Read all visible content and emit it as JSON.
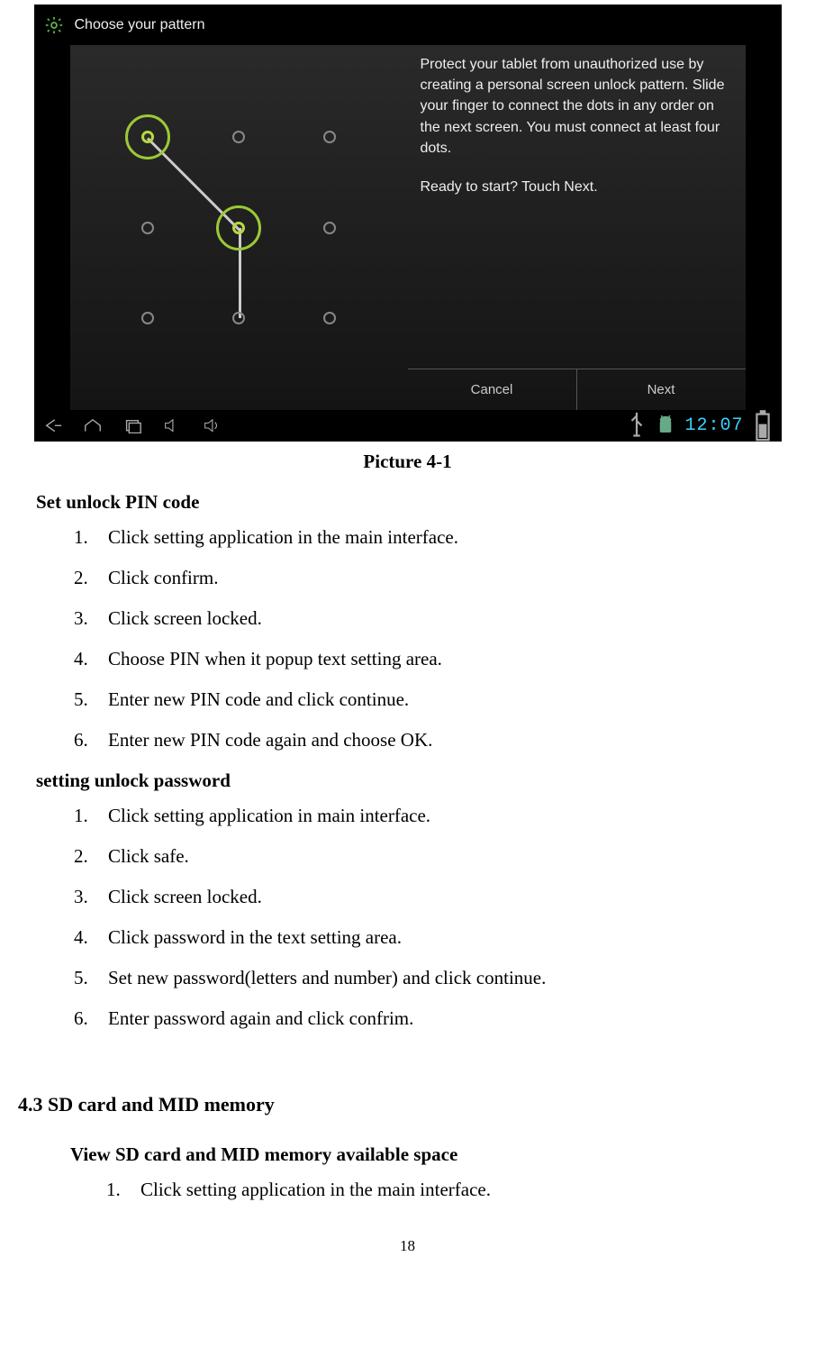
{
  "screenshot": {
    "title": "Choose your pattern",
    "instructions": "Protect your tablet from unauthorized use by creating a personal screen unlock pattern. Slide your finger to connect the dots in any order on the next screen. You must connect at least four dots.",
    "ready": "Ready to start? Touch Next.",
    "cancel": "Cancel",
    "next": "Next",
    "clock": "12:07"
  },
  "caption": "Picture 4-1",
  "pin": {
    "heading": "Set unlock PIN code",
    "steps": [
      "Click setting application in the main interface.",
      "Click confirm.",
      "Click screen locked.",
      "Choose PIN when it popup text setting area.",
      "Enter new PIN code and click continue.",
      "Enter new PIN code again and choose OK."
    ]
  },
  "password": {
    "heading": "setting unlock password",
    "steps": [
      "Click setting application in main interface.",
      "Click safe.",
      "Click screen locked.",
      "Click password in the text setting area.",
      "Set new password(letters and number) and click continue.",
      "Enter password again and click confrim."
    ]
  },
  "section43": "4.3 SD card and MID memory",
  "viewsd": {
    "heading": "View SD card and MID memory available space",
    "steps": [
      "Click setting application in the main interface."
    ]
  },
  "page": "18"
}
